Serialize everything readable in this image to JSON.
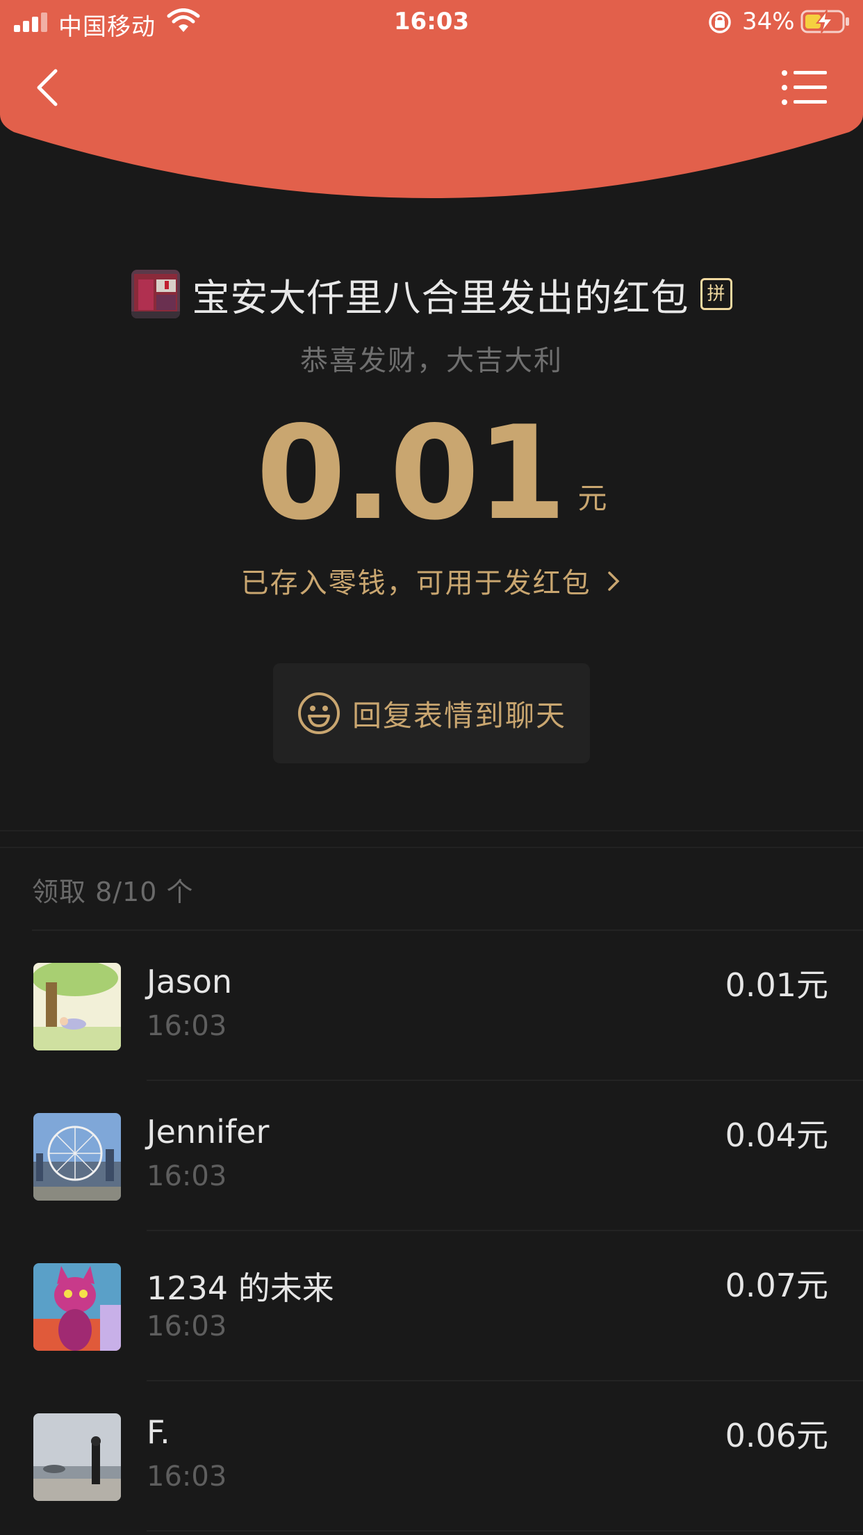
{
  "status_bar": {
    "carrier": "中国移动",
    "time": "16:03",
    "battery_percent": "34%"
  },
  "colors": {
    "header_red": "#E2604B",
    "gold": "#C9A670",
    "background": "#191919"
  },
  "nav": {
    "back_icon": "chevron-left-icon",
    "menu_icon": "list-menu-icon"
  },
  "envelope": {
    "sender_title": "宝安大仟里八合里发出的红包",
    "pin_badge": "拼",
    "blessing": "恭喜发财，大吉大利",
    "amount": "0.01",
    "unit": "元",
    "stored_text": "已存入零钱，可用于发红包",
    "reply_label": "回复表情到聊天"
  },
  "claims": {
    "summary": "领取 8/10 个",
    "items": [
      {
        "name": "Jason",
        "time": "16:03",
        "amount": "0.01元"
      },
      {
        "name": "Jennifer",
        "time": "16:03",
        "amount": "0.04元"
      },
      {
        "name": "1234 的未来",
        "time": "16:03",
        "amount": "0.07元"
      },
      {
        "name": "F.",
        "time": "16:03",
        "amount": "0.06元"
      }
    ]
  }
}
